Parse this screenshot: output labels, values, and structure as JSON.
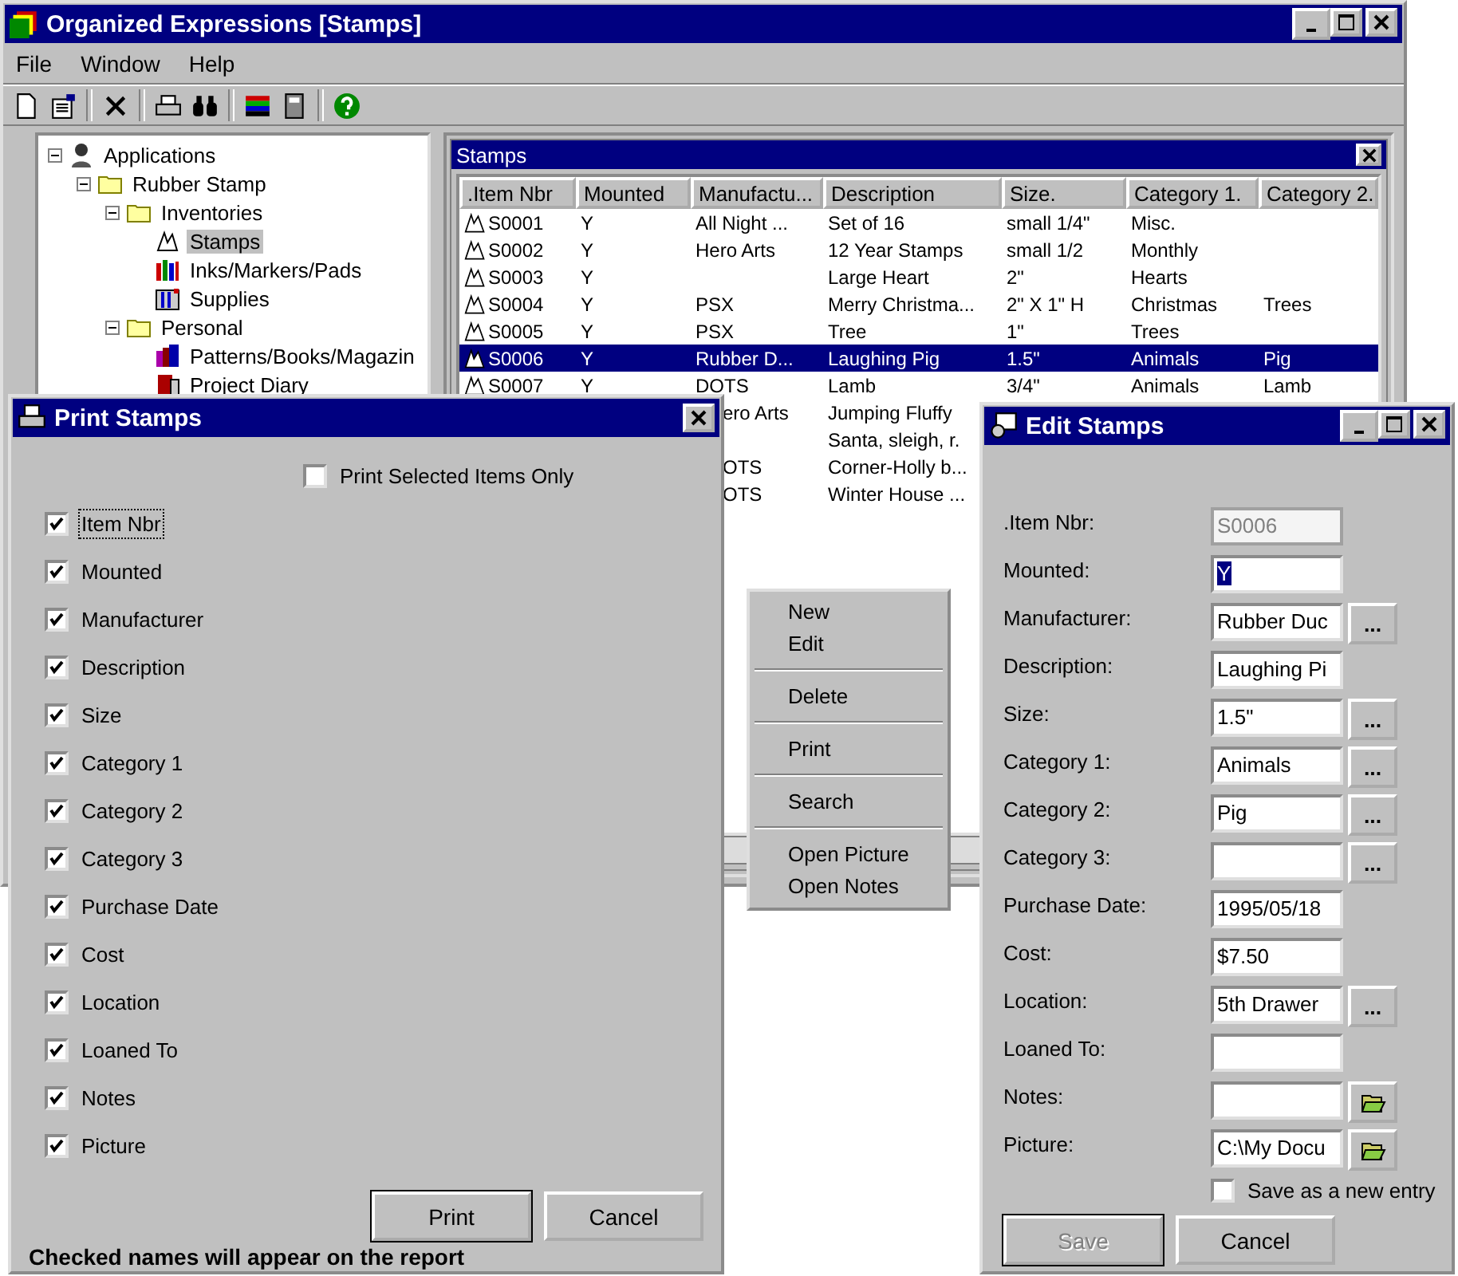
{
  "main_window": {
    "title": "Organized Expressions [Stamps]",
    "menu": [
      "File",
      "Window",
      "Help"
    ]
  },
  "tree": [
    {
      "label": "Applications",
      "kind": "root",
      "expanded": true,
      "selected": false,
      "children": [
        {
          "label": "Rubber Stamp",
          "kind": "folder",
          "expanded": true,
          "selected": false,
          "children": [
            {
              "label": "Inventories",
              "kind": "folder",
              "expanded": true,
              "selected": false,
              "children": [
                {
                  "label": "Stamps",
                  "kind": "stamps",
                  "selected": true
                },
                {
                  "label": "Inks/Markers/Pads",
                  "kind": "inks",
                  "selected": false
                },
                {
                  "label": "Supplies",
                  "kind": "supplies",
                  "selected": false
                }
              ]
            },
            {
              "label": "Personal",
              "kind": "folder",
              "expanded": true,
              "selected": false,
              "children": [
                {
                  "label": "Patterns/Books/Magazin",
                  "kind": "books",
                  "selected": false
                },
                {
                  "label": "Project Diary",
                  "kind": "diary",
                  "selected": false
                }
              ]
            }
          ]
        }
      ]
    }
  ],
  "stamps_window": {
    "title": "Stamps",
    "columns": [
      ".Item Nbr",
      "Mounted",
      "Manufactu...",
      "Description",
      "Size.",
      "Category 1.",
      "Category 2."
    ],
    "rows": [
      {
        "item": "S0001",
        "mounted": "Y",
        "manufacturer": "All Night ...",
        "description": "Set of 16",
        "size": "small 1/4\"",
        "category_1": "Misc.",
        "selected": false
      },
      {
        "item": "S0002",
        "mounted": "Y",
        "manufacturer": "Hero Arts",
        "description": "12 Year Stamps",
        "size": "small 1/2",
        "category_1": "Monthly",
        "selected": false
      },
      {
        "item": "S0003",
        "mounted": "Y",
        "description": "Large Heart",
        "size": "2\"",
        "category_1": "Hearts",
        "selected": false
      },
      {
        "item": "S0004",
        "mounted": "Y",
        "manufacturer": "PSX",
        "description": "Merry Christma...",
        "size": "2\" X 1\" H",
        "category_1": "Christmas",
        "category_2": "Trees",
        "selected": false
      },
      {
        "item": "S0005",
        "mounted": "Y",
        "manufacturer": "PSX",
        "description": "Tree",
        "size": "1\"",
        "category_1": "Trees",
        "selected": false
      },
      {
        "item": "S0006",
        "mounted": "Y",
        "manufacturer": "Rubber D...",
        "description": "Laughing Pig",
        "size": "1.5\"",
        "category_1": "Animals",
        "category_2": "Pig",
        "selected": true
      },
      {
        "item": "S0007",
        "mounted": "Y",
        "manufacturer": "DOTS",
        "description": "Lamb",
        "size": "3/4\"",
        "category_1": "Animals",
        "category_2": "Lamb",
        "selected": false
      },
      {
        "manufacturer": "ero Arts",
        "description": "Jumping Fluffy",
        "selected": false
      },
      {
        "description": "Santa, sleigh, r.",
        "selected": false
      },
      {
        "manufacturer": "OTS",
        "description": "Corner-Holly b...",
        "selected": false
      },
      {
        "manufacturer": "OTS",
        "description": "Winter House ...",
        "selected": false
      }
    ]
  },
  "context_menu": {
    "groups": [
      [
        "New",
        "Edit"
      ],
      [
        "Delete"
      ],
      [
        "Print"
      ],
      [
        "Search"
      ],
      [
        "Open Picture",
        "Open Notes"
      ]
    ]
  },
  "print_dialog": {
    "title": "Print Stamps",
    "selected_only": {
      "label": "Print Selected Items Only",
      "checked": false
    },
    "fields": [
      {
        "label": "Item Nbr",
        "checked": true,
        "focused": true
      },
      {
        "label": "Mounted",
        "checked": true,
        "focused": false
      },
      {
        "label": "Manufacturer",
        "checked": true,
        "focused": false
      },
      {
        "label": "Description",
        "checked": true,
        "focused": false
      },
      {
        "label": "Size",
        "checked": true,
        "focused": false
      },
      {
        "label": "Category 1",
        "checked": true,
        "focused": false
      },
      {
        "label": "Category 2",
        "checked": true,
        "focused": false
      },
      {
        "label": "Category 3",
        "checked": true,
        "focused": false
      },
      {
        "label": "Purchase Date",
        "checked": true,
        "focused": false
      },
      {
        "label": "Cost",
        "checked": true,
        "focused": false
      },
      {
        "label": "Location",
        "checked": true,
        "focused": false
      },
      {
        "label": "Loaned To",
        "checked": true,
        "focused": false
      },
      {
        "label": "Notes",
        "checked": true,
        "focused": false
      },
      {
        "label": "Picture",
        "checked": true,
        "focused": false
      }
    ],
    "buttons": [
      {
        "label": "Print",
        "default": true
      },
      {
        "label": "Cancel",
        "default": false
      }
    ],
    "footer": "Checked names will appear on the report"
  },
  "edit_dialog": {
    "title": "Edit Stamps",
    "fields": [
      {
        "label": ".Item Nbr:",
        "value": "S0006",
        "disabled": true
      },
      {
        "label": "Mounted:",
        "value": "Y",
        "disabled": false,
        "value_selected": true
      },
      {
        "label": "Manufacturer:",
        "value": "Rubber Duc",
        "disabled": false,
        "action": {
          "kind": "ellipsis",
          "label": "..."
        }
      },
      {
        "label": "Description:",
        "value": "Laughing Pi",
        "disabled": false
      },
      {
        "label": "Size:",
        "value": "1.5\"",
        "disabled": false,
        "action": {
          "kind": "ellipsis",
          "label": "..."
        }
      },
      {
        "label": "Category 1:",
        "value": "Animals",
        "disabled": false,
        "action": {
          "kind": "ellipsis",
          "label": "..."
        }
      },
      {
        "label": "Category 2:",
        "value": "Pig",
        "disabled": false,
        "action": {
          "kind": "ellipsis",
          "label": "..."
        }
      },
      {
        "label": "Category 3:",
        "disabled": false,
        "action": {
          "kind": "ellipsis",
          "label": "..."
        }
      },
      {
        "label": "Purchase Date:",
        "value": "1995/05/18",
        "disabled": false
      },
      {
        "label": "Cost:",
        "value": "$7.50",
        "disabled": false
      },
      {
        "label": "Location:",
        "value": "5th Drawer",
        "disabled": false,
        "action": {
          "kind": "ellipsis",
          "label": "..."
        }
      },
      {
        "label": "Loaned To:",
        "disabled": false
      },
      {
        "label": "Notes:",
        "disabled": false,
        "action": {
          "kind": "folder"
        }
      },
      {
        "label": "Picture:",
        "value": "C:\\My Docu",
        "disabled": false,
        "action": {
          "kind": "folder"
        }
      }
    ],
    "save_as_new": {
      "label": "Save as a new entry",
      "checked": false
    },
    "buttons": [
      {
        "label": "Save",
        "disabled": true,
        "default": true
      },
      {
        "label": "Cancel",
        "disabled": false,
        "default": false
      }
    ]
  }
}
